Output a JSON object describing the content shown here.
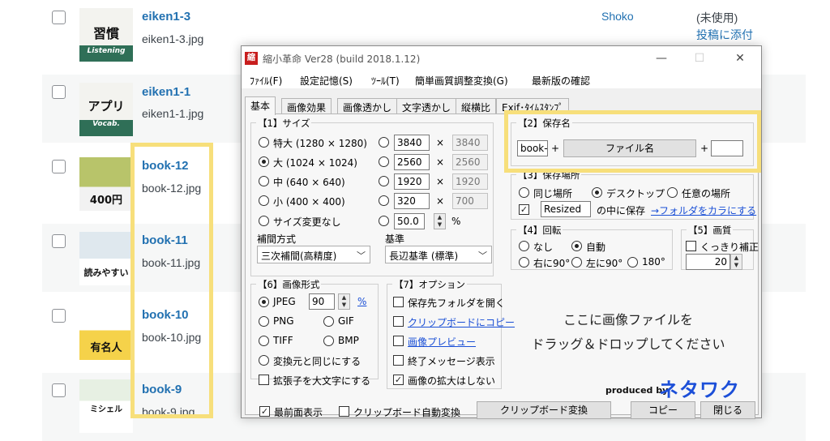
{
  "media_rows": [
    {
      "title": "eiken1-3",
      "file": "eiken1-3.jpg",
      "thumb_text": "習慣",
      "thumb_sub": "Listening",
      "author": "Shoko",
      "status": "(未使用)",
      "attach": "投稿に添付"
    },
    {
      "title": "eiken1-1",
      "file": "eiken1-1.jpg",
      "thumb_text": "アプリ",
      "thumb_sub": "Vocab."
    },
    {
      "title": "book-12",
      "file": "book-12.jpg",
      "thumb_text": "400円"
    },
    {
      "title": "book-11",
      "file": "book-11.jpg",
      "thumb_text": "読みやすい"
    },
    {
      "title": "book-10",
      "file": "book-10.jpg",
      "thumb_text": "有名人"
    },
    {
      "title": "book-9",
      "file": "book-9.jpg",
      "thumb_text": "ミシェル"
    }
  ],
  "window": {
    "icon_char": "縮",
    "title": "縮小革命 Ver28 (build 2018.1.12)",
    "minimize": "—",
    "maximize": "☐",
    "close": "✕"
  },
  "menu": [
    "ﾌｧｲﾙ(F)",
    "設定記憶(S)",
    "ﾂｰﾙ(T)",
    "簡単画質調整変換(G)",
    "最新版の確認"
  ],
  "tabs": [
    "基本",
    "画像効果",
    "画像透かし",
    "文字透かし",
    "縦横比",
    "Exif･ﾀｲﾑｽﾀﾝﾌﾟ"
  ],
  "size": {
    "label": "【1】サイズ",
    "presets": [
      "特大 (1280 × 1280)",
      "大 (1024 × 1024)",
      "中 (640 × 640)",
      "小 (400 × 400)"
    ],
    "widths": [
      "3840",
      "2560",
      "1920",
      "320"
    ],
    "heights": [
      "3840",
      "2560",
      "1920",
      "700"
    ],
    "times": "×",
    "no_resize": "サイズ変更なし",
    "percent_value": "50.0",
    "percent_unit": "%"
  },
  "interp": {
    "label": "補間方式",
    "value": "三次補間(高精度)"
  },
  "basis": {
    "label": "基準",
    "value": "長辺基準 (標準)"
  },
  "filename": {
    "label": "【2】保存名",
    "prefix": "book-",
    "plus": "+",
    "button": "ファイル名",
    "suffix": ""
  },
  "location": {
    "label": "【3】保存場所",
    "same": "同じ場所",
    "desktop": "デスクトップ",
    "any": "任意の場所",
    "folder": "Resized",
    "inside": "の中に保存",
    "empty_link": "→フォルダをカラにする"
  },
  "rotation": {
    "label": "【4】回転",
    "none": "なし",
    "auto": "自動",
    "right": "右に90°",
    "left": "左に90°",
    "r180": "180°"
  },
  "quality": {
    "label": "【5】画質",
    "sharp": "くっきり補正",
    "value": "20"
  },
  "format": {
    "label": "【6】画像形式",
    "jpeg": "JPEG",
    "jpeg_q": "90",
    "pct": "%",
    "png": "PNG",
    "gif": "GIF",
    "tiff": "TIFF",
    "bmp": "BMP",
    "same": "変換元と同じにする",
    "upper": "拡張子を大文字にする"
  },
  "options": {
    "label": "【7】オプション",
    "open_folder": "保存先フォルダを開く",
    "clipboard_copy": "クリップボードにコピー",
    "preview": "画像プレビュー",
    "end_msg": "終了メッセージ表示",
    "no_enlarge": "画像の拡大はしない"
  },
  "drop": {
    "line1": "ここに画像ファイルを",
    "line2": "ドラッグ＆ドロップしてください"
  },
  "brand": {
    "produced": "produced by",
    "name": "ネタワク"
  },
  "bottom": {
    "topmost": "最前面表示",
    "auto_clip": "クリップボード自動変換",
    "clip_convert": "クリップボード変換",
    "copy": "コピー",
    "close": "閉じる"
  },
  "colors": {
    "accent_yellow": "#f7df7b",
    "link_blue": "#2271b1",
    "brand_blue": "#1c4fd8"
  }
}
